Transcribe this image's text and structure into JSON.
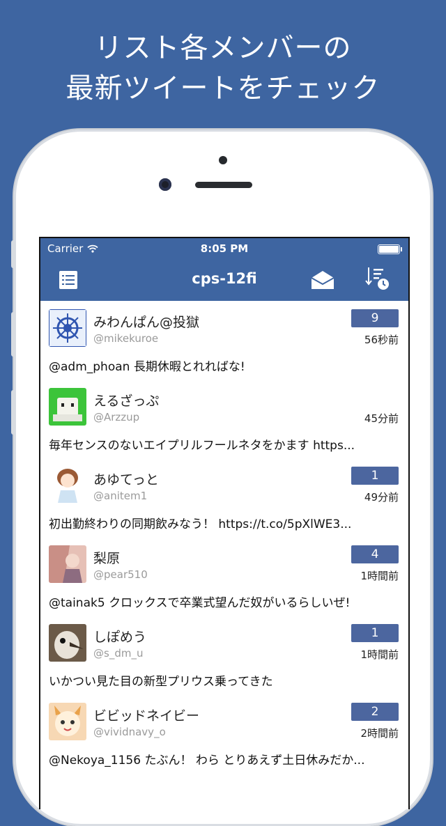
{
  "headline": {
    "line1": "リスト各メンバーの",
    "line2": "最新ツイートをチェック"
  },
  "status_bar": {
    "carrier": "Carrier",
    "time": "8:05 PM"
  },
  "nav": {
    "title": "cps-12fi"
  },
  "tweets": [
    {
      "name": "みわんぱん@投獄",
      "handle": "@mikekuroe",
      "badge": "9",
      "time": "56秒前",
      "text": "@adm_phoan 長期休暇とれればな!"
    },
    {
      "name": "えるざっぷ",
      "handle": "@Arzzup",
      "badge": "",
      "time": "45分前",
      "text": "毎年センスのないエイプリルフールネタをかます https..."
    },
    {
      "name": "あゆてっと",
      "handle": "@anitem1",
      "badge": "1",
      "time": "49分前",
      "text": "初出勤終わりの同期飲みなう！ https://t.co/5pXlWE3..."
    },
    {
      "name": "梨原",
      "handle": "@pear510",
      "badge": "4",
      "time": "1時間前",
      "text": "@tainak5 クロックスで卒業式望んだ奴がいるらしいぜ!"
    },
    {
      "name": "しぽめう",
      "handle": "@s_dm_u",
      "badge": "1",
      "time": "1時間前",
      "text": "いかつい見た目の新型プリウス乗ってきた"
    },
    {
      "name": "ビビッドネイビー",
      "handle": "@vividnavy_o",
      "badge": "2",
      "time": "2時間前",
      "text": "@Nekoya_1156 たぶん！ わら とりあえず土日休みだか..."
    }
  ],
  "colors": {
    "brand": "#3e65a1",
    "badge": "#4c669f"
  }
}
